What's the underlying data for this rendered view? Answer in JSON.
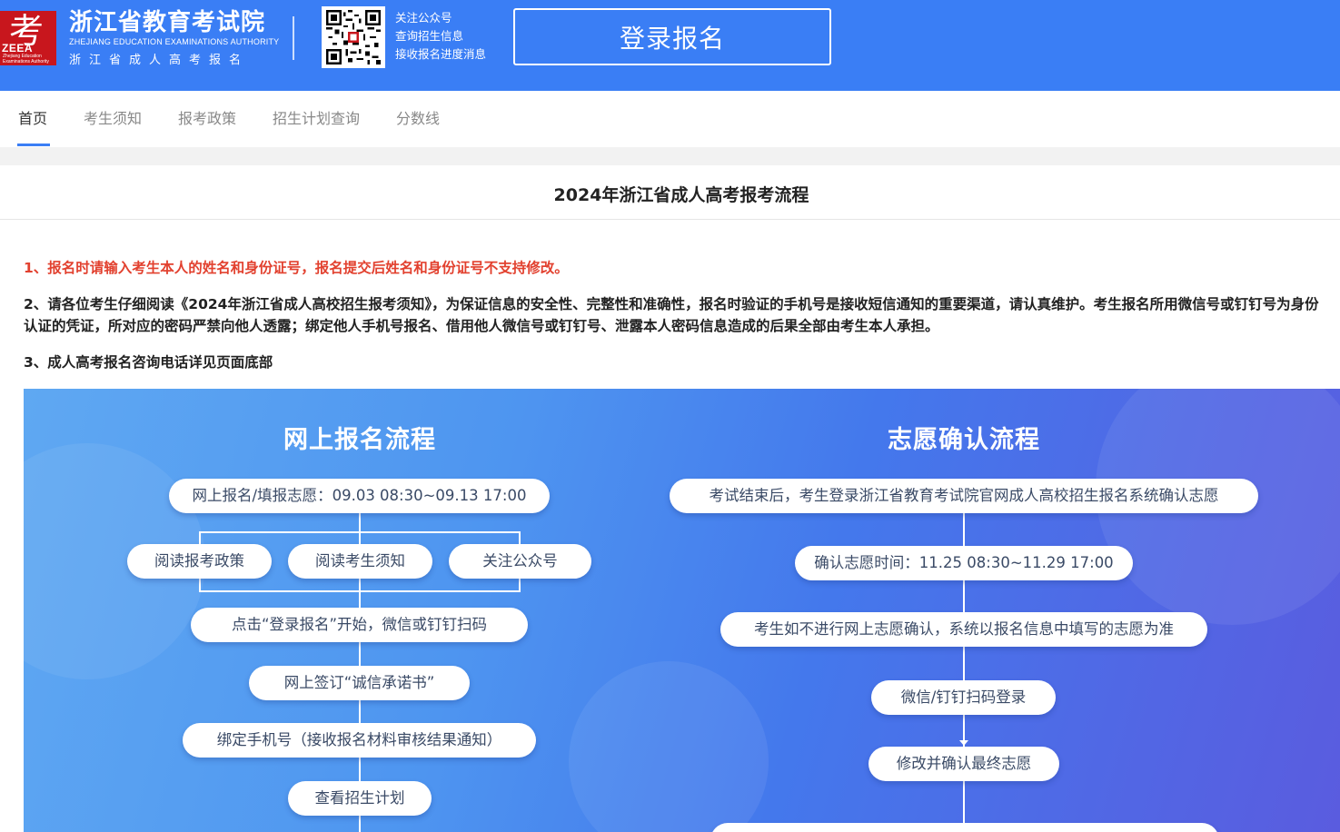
{
  "header": {
    "logo_char": "考",
    "logo_abbr": "ZEEA",
    "logo_small": "Zhejiang Education Examinations Authority",
    "org_name_cn": "浙江省教育考试院",
    "org_name_en": "ZHEJIANG EDUCATION EXAMINATIONS AUTHORITY",
    "org_subtitle": "浙江省成人高考报名",
    "qr_lines": [
      "关注公众号",
      "查询招生信息",
      "接收报名进度消息"
    ],
    "login_button": "登录报名"
  },
  "nav": {
    "items": [
      "首页",
      "考生须知",
      "报考政策",
      "招生计划查询",
      "分数线"
    ],
    "active_index": 0
  },
  "content": {
    "title": "2024年浙江省成人高考报考流程",
    "notices": [
      "1、报名时请输入考生本人的姓名和身份证号，报名提交后姓名和身份证号不支持修改。",
      "2、请各位考生仔细阅读《2024年浙江省成人高校招生报考须知》，为保证信息的安全性、完整性和准确性，报名时验证的手机号是接收短信通知的重要渠道，请认真维护。考生报名所用微信号或钉钉号为身份认证的凭证，所对应的密码严禁向他人透露；绑定他人手机号报名、借用他人微信号或钉钉号、泄露本人密码信息造成的后果全部由考生本人承担。",
      "3、成人高考报名咨询电话详见页面底部"
    ]
  },
  "flow": {
    "online_title": "网上报名流程",
    "online_steps": {
      "period": "网上报名/填报志愿：09.03 08:30~09.13 17:00",
      "read_policy": "阅读报考政策",
      "read_notice": "阅读考生须知",
      "follow_account": "关注公众号",
      "click_login": "点击“登录报名”开始，微信或钉钉扫码",
      "sign_pledge": "网上签订“诚信承诺书”",
      "bind_phone": "绑定手机号（接收报名材料审核结果通知）",
      "view_plan": "查看招生计划"
    },
    "confirm_title": "志愿确认流程",
    "confirm_steps": {
      "after_exam": "考试结束后，考生登录浙江省教育考试院官网成人高校招生报名系统确认志愿",
      "confirm_time": "确认志愿时间：11.25 08:30~11.29 17:00",
      "default_rule": "考生如不进行网上志愿确认，系统以报名信息中填写的志愿为准",
      "scan_login": "微信/钉钉扫码登录",
      "modify_confirm": "修改并确认最终志愿"
    }
  },
  "colors": {
    "header_blue": "#3a7ef5",
    "logo_red": "#c8161d",
    "notice_red": "#e2412f",
    "banner_start": "#5fa8f2",
    "banner_end": "#5a5cdf"
  },
  "icons": {
    "qr": "qr-code-icon",
    "logo": "zeea-logo-icon"
  }
}
